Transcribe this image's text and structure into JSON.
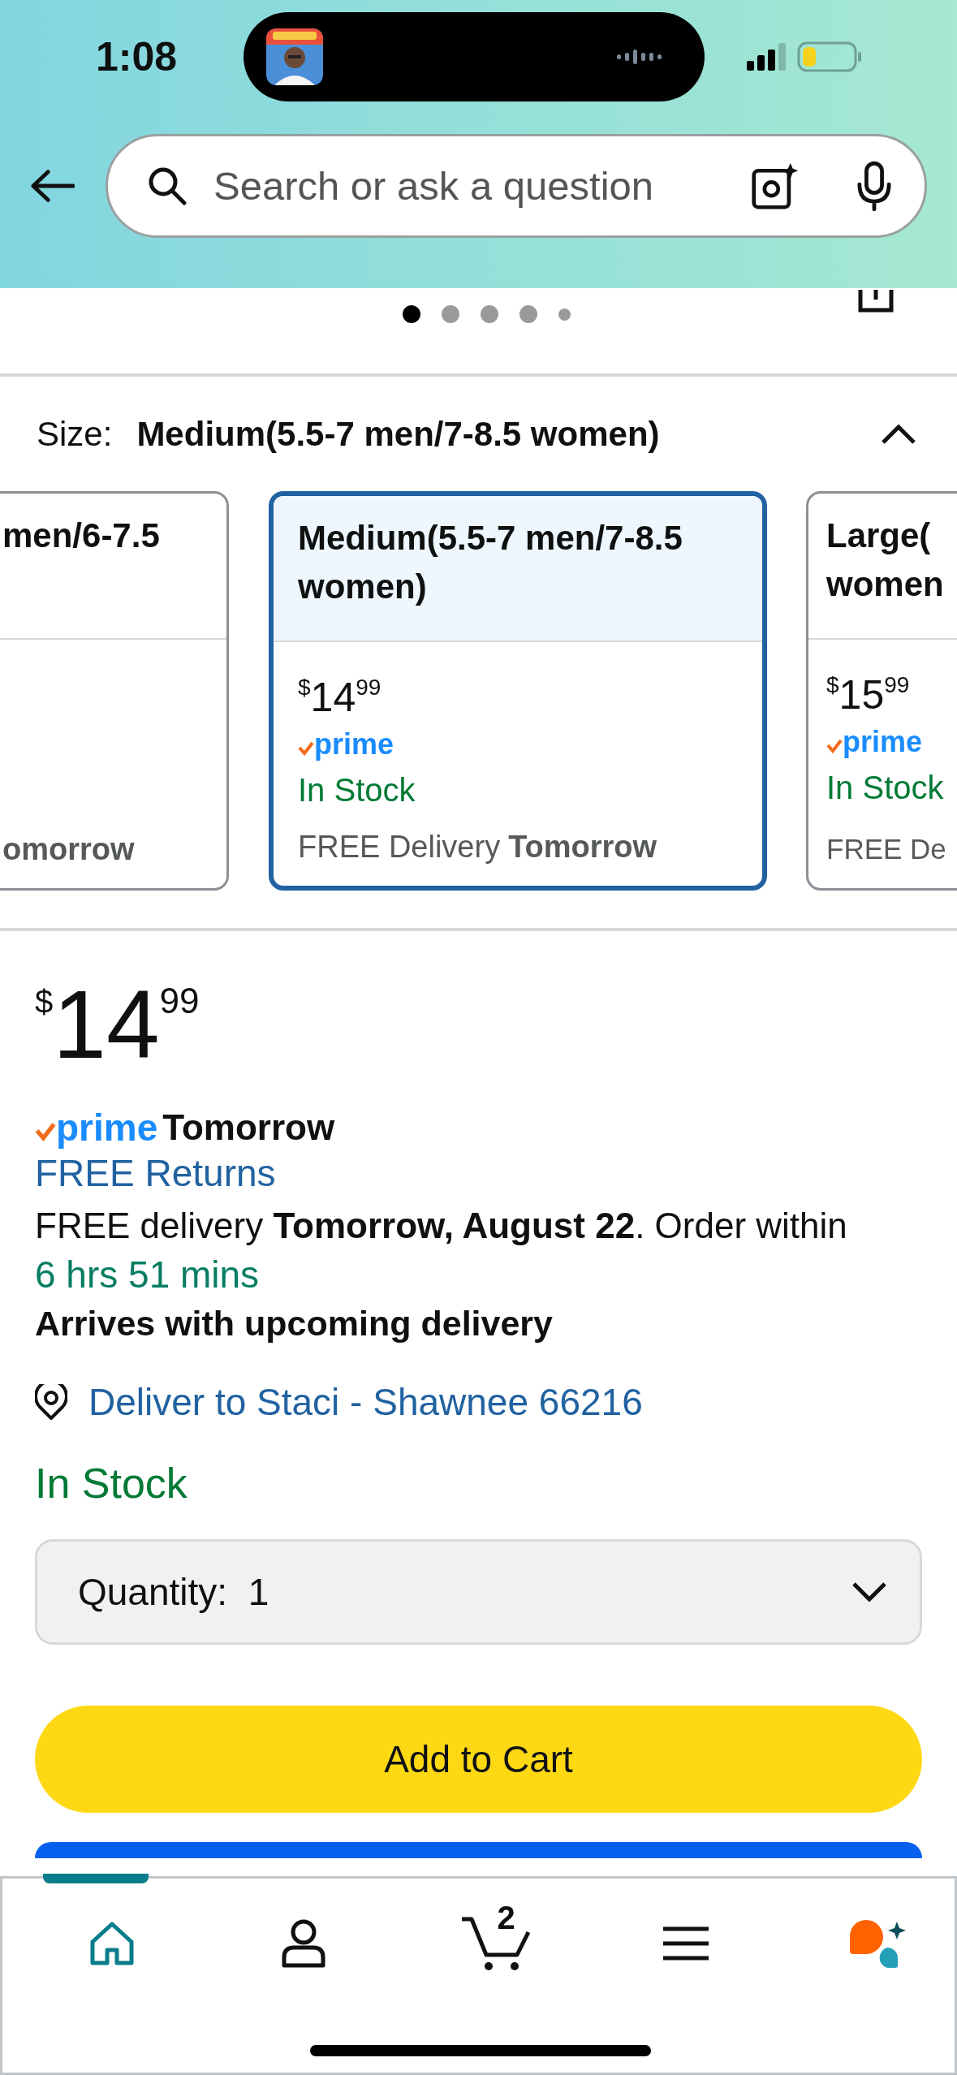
{
  "status_bar": {
    "time": "1:08"
  },
  "search": {
    "placeholder": "Search or ask a question"
  },
  "carousel_dots": [
    {
      "selected": true
    },
    {
      "selected": false
    },
    {
      "selected": false
    },
    {
      "selected": false
    },
    {
      "selected": false
    }
  ],
  "size_selector": {
    "label": "Size:",
    "value": "Medium(5.5-7 men/7-8.5 women)",
    "expanded": true
  },
  "size_options": [
    {
      "title": "men/6-7.5",
      "delivery_day": "omorrow",
      "selected": false
    },
    {
      "title": "Medium(5.5-7 men/7-8.5 women)",
      "price_symbol": "$",
      "price_whole": "14",
      "price_fraction": "99",
      "prime": "prime",
      "stock": "In Stock",
      "delivery_label": "FREE Delivery",
      "delivery_day": "Tomorrow",
      "selected": true
    },
    {
      "title": "Large( women",
      "price_symbol": "$",
      "price_whole": "15",
      "price_fraction": "99",
      "prime": "prime",
      "stock": "In Stock",
      "delivery_label": "FREE De",
      "selected": false
    }
  ],
  "price": {
    "symbol": "$",
    "whole": "14",
    "fraction": "99"
  },
  "prime_delivery": {
    "badge": "prime",
    "day": "Tomorrow"
  },
  "returns_link": "FREE Returns",
  "delivery_message": "FREE delivery **Tomorrow, August 22**. Order within",
  "countdown": "6 hrs 51 mins",
  "arrival_note": "Arrives with upcoming delivery",
  "deliver_to": "Deliver to Staci - Shawnee 66216",
  "availability": "In Stock",
  "quantity": {
    "label": "Quantity:",
    "value": "1"
  },
  "add_to_cart": "Add to Cart",
  "tab_bar": [
    {
      "kind": "home",
      "selected": true
    },
    {
      "kind": "account",
      "selected": false
    },
    {
      "kind": "cart",
      "count": "2",
      "selected": false
    },
    {
      "kind": "menu",
      "selected": false
    },
    {
      "kind": "assistant",
      "selected": false
    }
  ]
}
